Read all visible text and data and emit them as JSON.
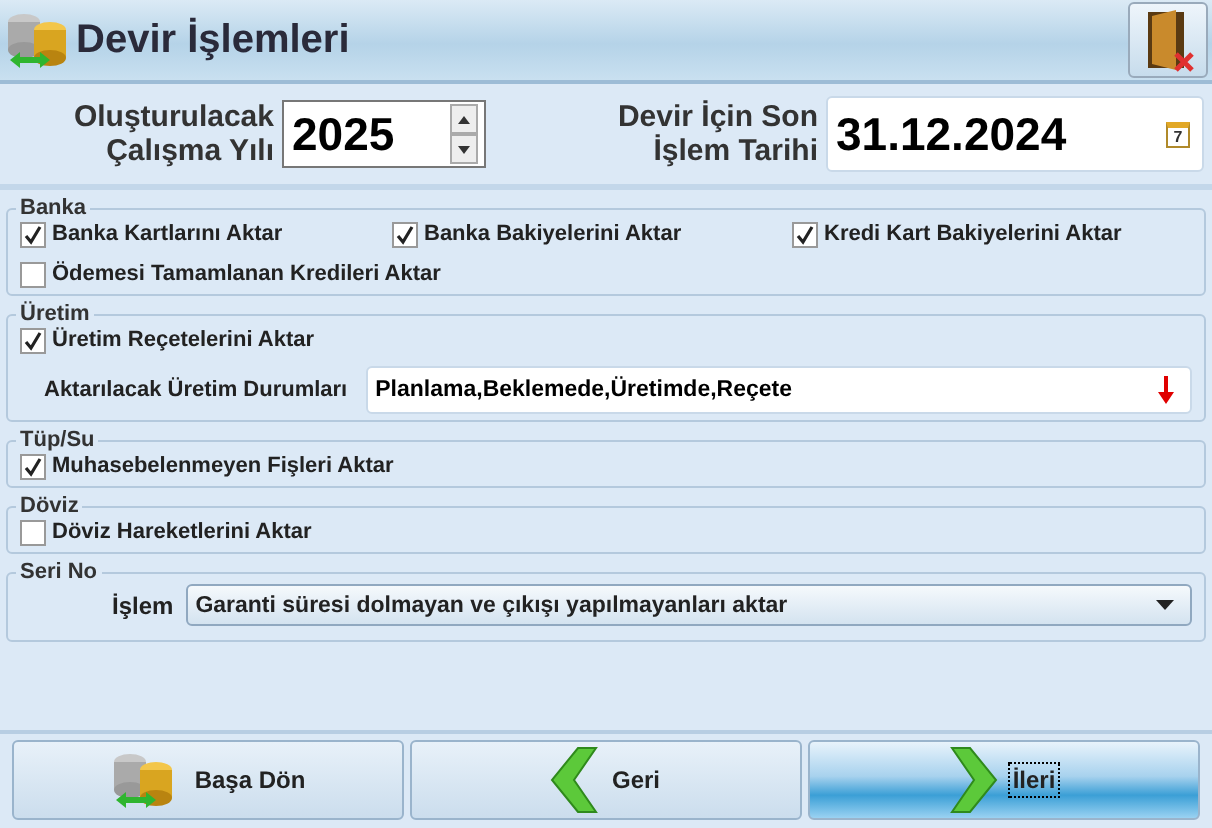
{
  "window": {
    "title": "Devir İşlemleri"
  },
  "year_field": {
    "label_lines": [
      "Oluşturulacak",
      "Çalışma Yılı"
    ],
    "value": "2025"
  },
  "date_field": {
    "label_lines": [
      "Devir İçin Son",
      "İşlem Tarihi"
    ],
    "value": "31.12.2024",
    "calendar_day": "7"
  },
  "groups": [
    {
      "title": "Banka",
      "items": [
        {
          "kind": "checkbox",
          "label": "Banka Kartlarını Aktar",
          "checked": true
        },
        {
          "kind": "checkbox",
          "label": "Banka Bakiyelerini Aktar",
          "checked": true
        },
        {
          "kind": "checkbox",
          "label": "Kredi Kart Bakiyelerini Aktar",
          "checked": true
        },
        {
          "kind": "checkbox",
          "label": "Ödemesi Tamamlanan Kredileri Aktar",
          "checked": false
        }
      ]
    },
    {
      "title": "Üretim",
      "items": [
        {
          "kind": "checkbox",
          "label": "Üretim Reçetelerini Aktar",
          "checked": true
        },
        {
          "kind": "multiselect",
          "label": "Aktarılacak Üretim Durumları",
          "value": "Planlama,Beklemede,Üretimde,Reçete"
        }
      ]
    },
    {
      "title": "Tüp/Su",
      "items": [
        {
          "kind": "checkbox",
          "label": "Muhasebelenmeyen Fişleri Aktar",
          "checked": true
        }
      ]
    },
    {
      "title": "Döviz",
      "items": [
        {
          "kind": "checkbox",
          "label": "Döviz Hareketlerini Aktar",
          "checked": false
        }
      ]
    },
    {
      "title": "Seri No",
      "items": [
        {
          "kind": "combo",
          "label": "İşlem",
          "value": "Garanti süresi dolmayan ve çıkışı yapılmayanları aktar"
        }
      ]
    }
  ],
  "buttons": [
    {
      "kind": "coins",
      "label": "Başa Dön",
      "focused": false
    },
    {
      "kind": "back",
      "label": "Geri",
      "focused": false
    },
    {
      "kind": "forward",
      "label": "İleri",
      "focused": true
    }
  ]
}
